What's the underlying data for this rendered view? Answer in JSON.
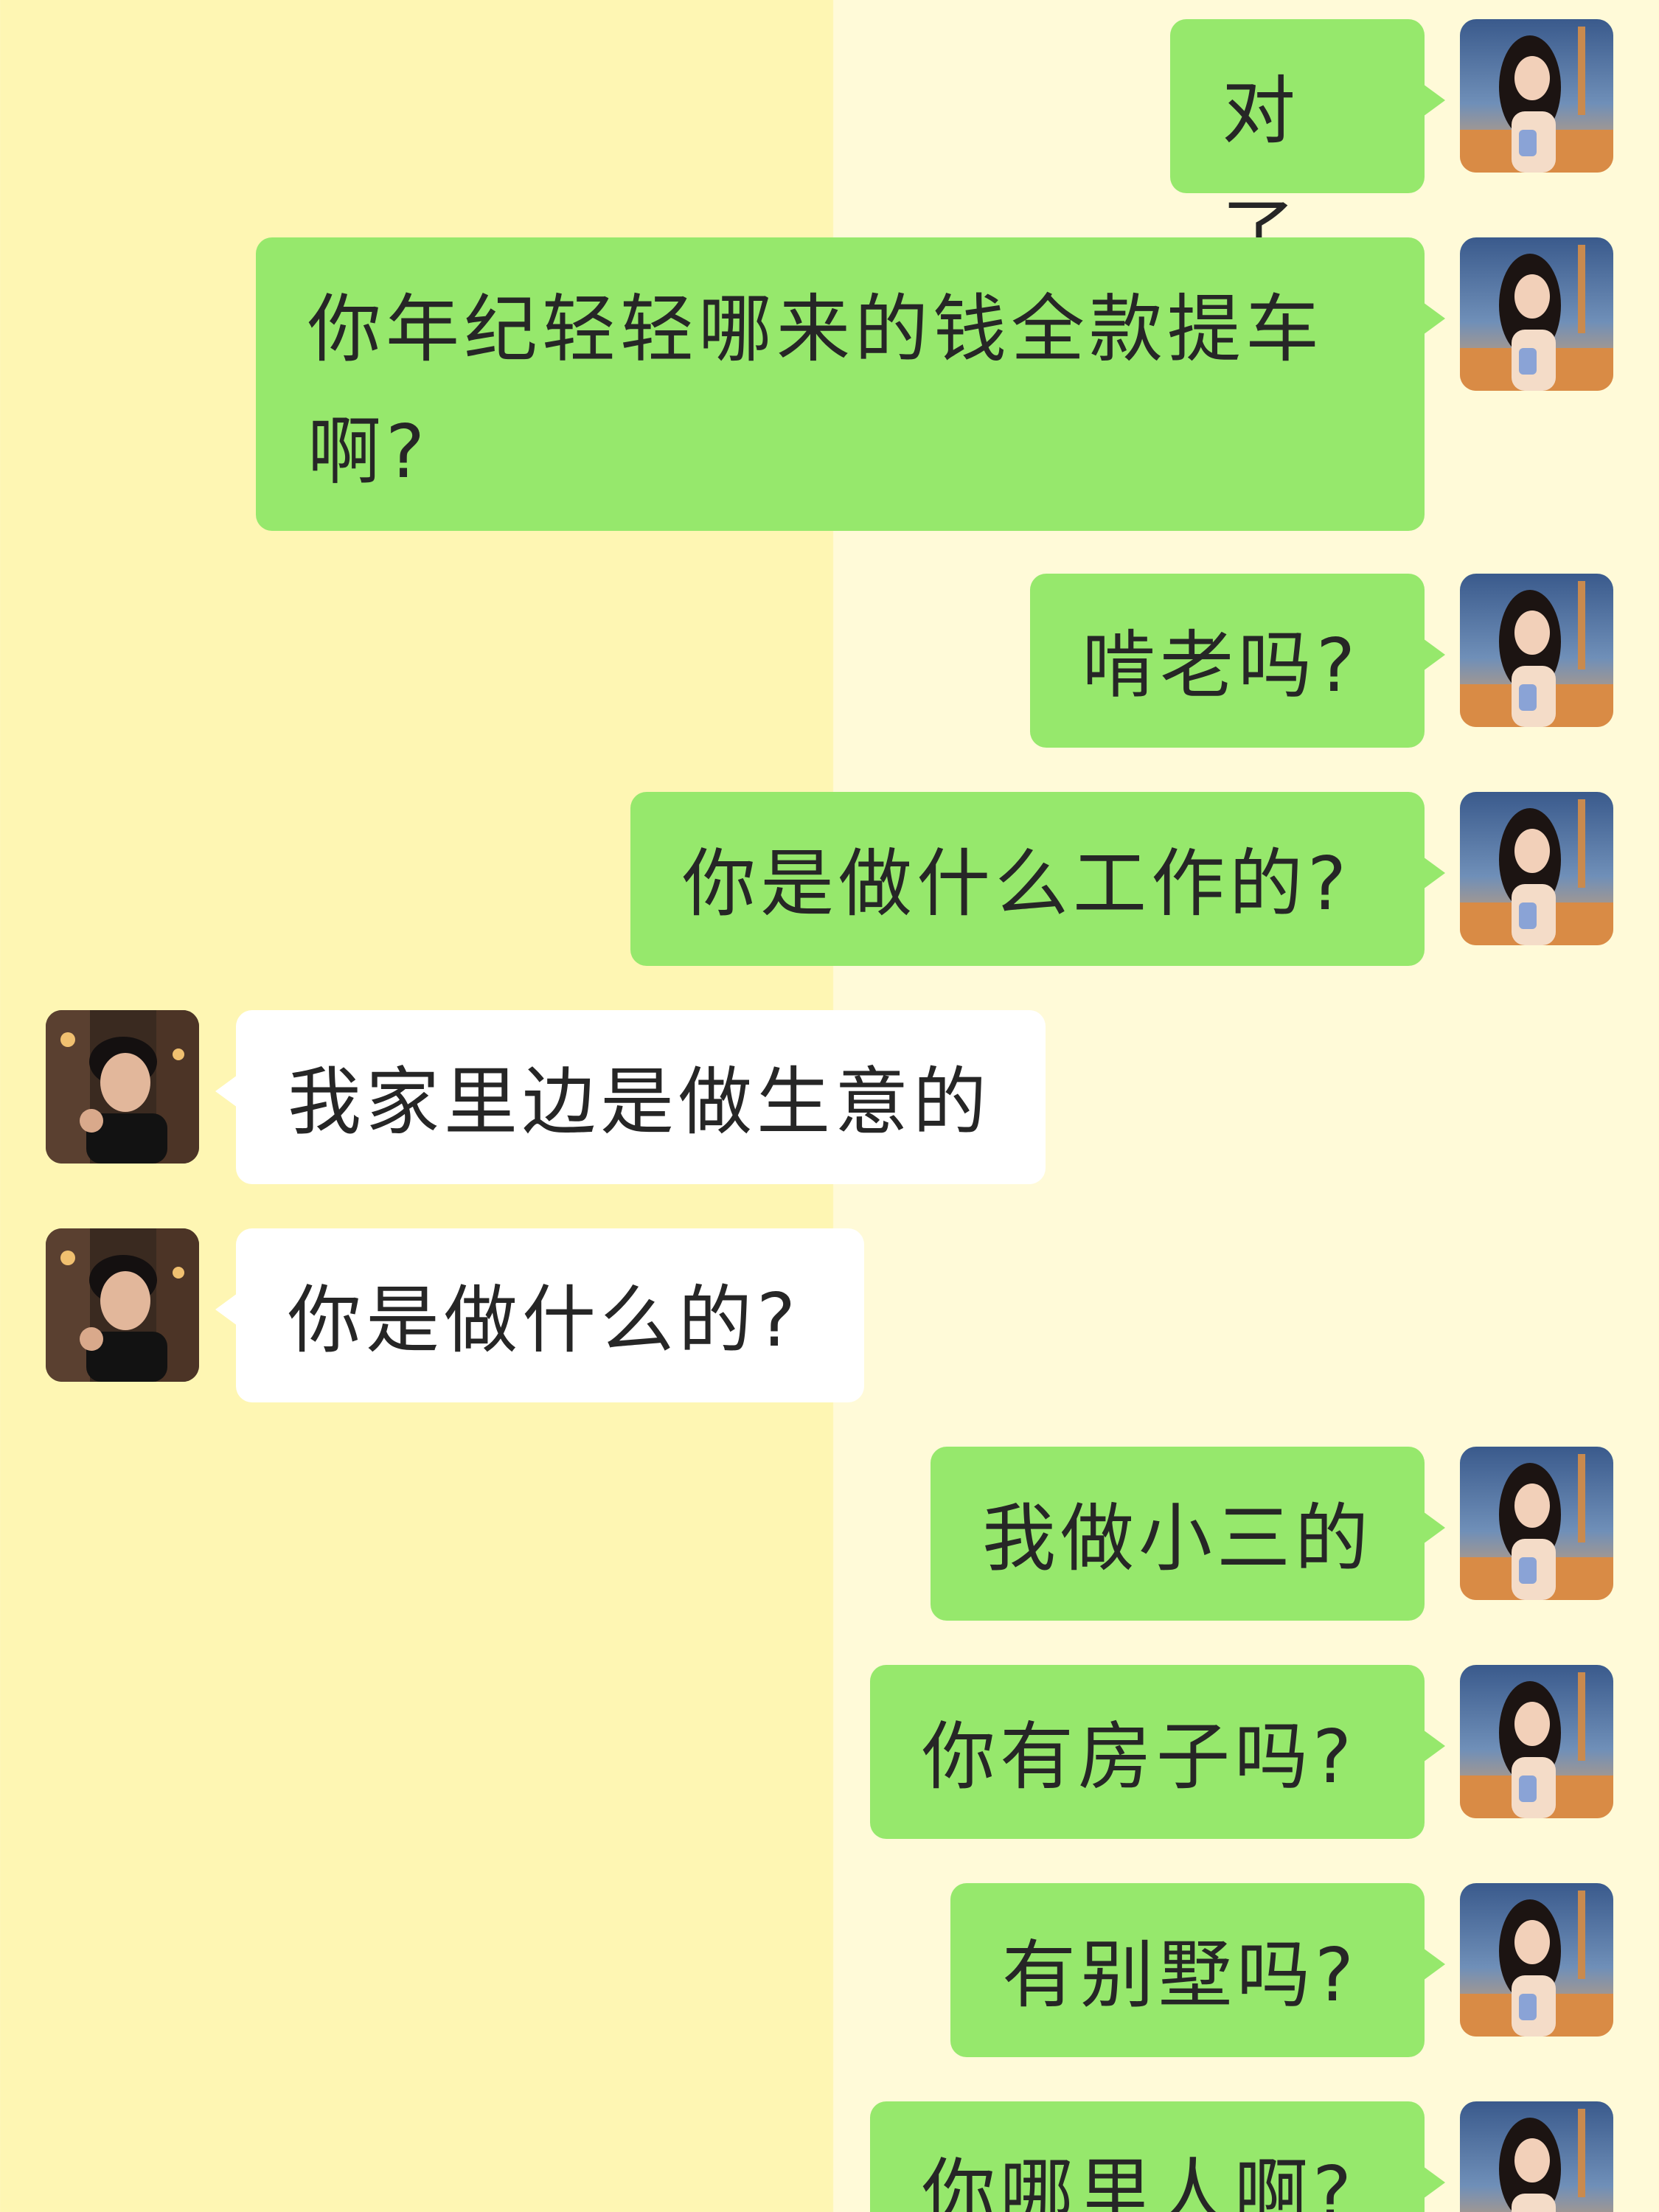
{
  "chat": {
    "messages": [
      {
        "side": "outgoing",
        "text": "对了"
      },
      {
        "side": "outgoing",
        "text": "你年纪轻轻哪来的钱全款提车啊?"
      },
      {
        "side": "outgoing",
        "text": "啃老吗?"
      },
      {
        "side": "outgoing",
        "text": "你是做什么工作的?"
      },
      {
        "side": "incoming",
        "text": "我家里边是做生意的"
      },
      {
        "side": "incoming",
        "text": "你是做什么的?"
      },
      {
        "side": "outgoing",
        "text": "我做小三的"
      },
      {
        "side": "outgoing",
        "text": "你有房子吗?"
      },
      {
        "side": "outgoing",
        "text": "有别墅吗?"
      },
      {
        "side": "outgoing",
        "text": "你哪里人啊?"
      }
    ]
  },
  "avatars": {
    "self": "woman-photo-avatar",
    "contact": "man-photo-avatar"
  },
  "colors": {
    "background_left": "#fef6b3",
    "background_right": "#fffad8",
    "outgoing_bubble": "#96e86c",
    "incoming_bubble": "#ffffff",
    "text": "#262626"
  }
}
